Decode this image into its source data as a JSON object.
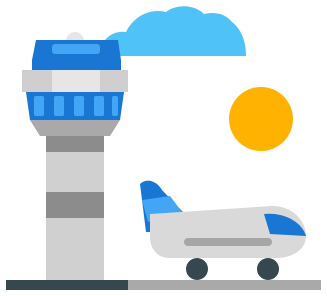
{
  "illustration": {
    "subject": "airport",
    "icons": [
      "control-tower-icon",
      "airplane-icon",
      "cloud-icon",
      "sun-icon",
      "runway-ground"
    ],
    "colors": {
      "cloud": "#4FC3F7",
      "sun": "#FFB300",
      "tower_blue": "#1976D2",
      "tower_blue_light": "#42A5F5",
      "tower_cap": "#E6E6E6",
      "tower_band": "#CFCFCF",
      "tower_gray_dark": "#8C8C8C",
      "tower_gray_mid": "#A9A9A9",
      "tower_gray_light": "#D0D0D0",
      "plane_body": "#D9D9D9",
      "plane_stripe": "#A6A6A6",
      "plane_tail": "#1976D2",
      "plane_tail_stripe": "#42A5F5",
      "plane_window": "#1976D2",
      "wheels": "#37474F",
      "ground_dark": "#37474F",
      "ground_light": "#A9A9A9"
    }
  }
}
